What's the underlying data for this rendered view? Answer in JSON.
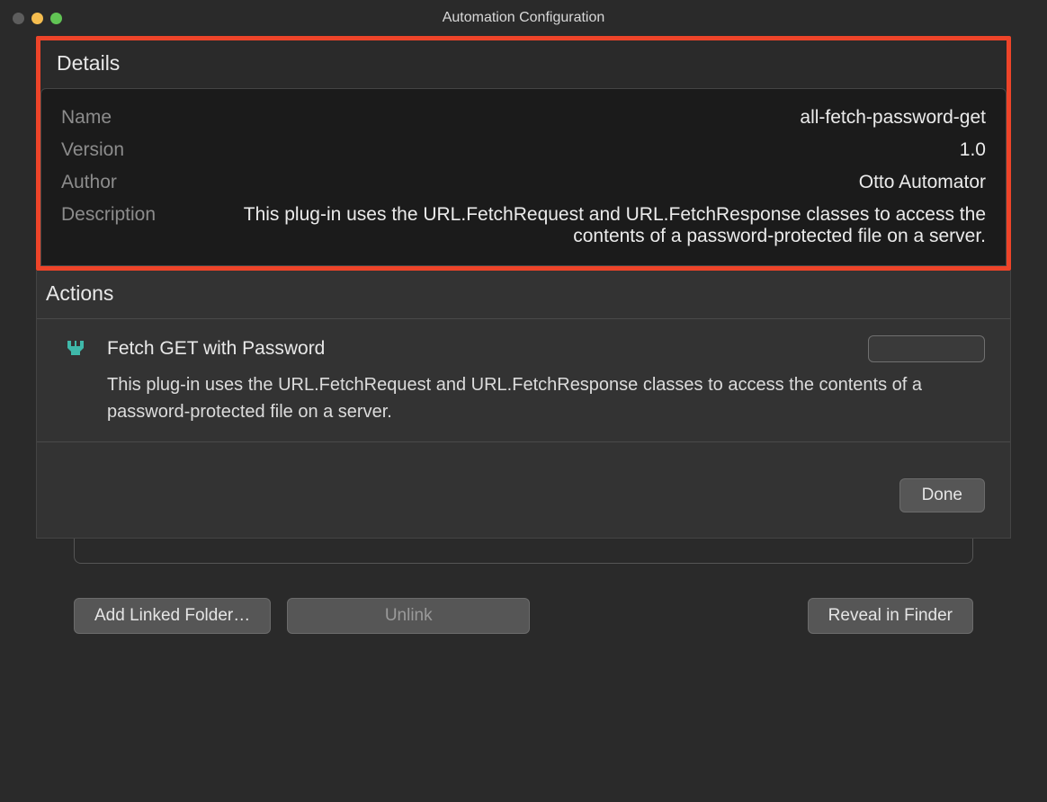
{
  "window": {
    "title": "Automation Configuration"
  },
  "details": {
    "header": "Details",
    "fields": {
      "name_label": "Name",
      "name_value": "all-fetch-password-get",
      "version_label": "Version",
      "version_value": "1.0",
      "author_label": "Author",
      "author_value": "Otto Automator",
      "description_label": "Description",
      "description_value": "This plug-in uses the URL.FetchRequest and URL.FetchResponse classes to access the contents of a password-protected file on a server."
    }
  },
  "actions": {
    "header": "Actions",
    "items": [
      {
        "title": "Fetch GET with Password",
        "description": "This plug-in uses the URL.FetchRequest and URL.FetchResponse classes to access the contents of a password-protected file on a server."
      }
    ]
  },
  "buttons": {
    "done": "Done",
    "add_linked_folder": "Add Linked Folder…",
    "unlink": "Unlink",
    "reveal_in_finder": "Reveal in Finder"
  }
}
